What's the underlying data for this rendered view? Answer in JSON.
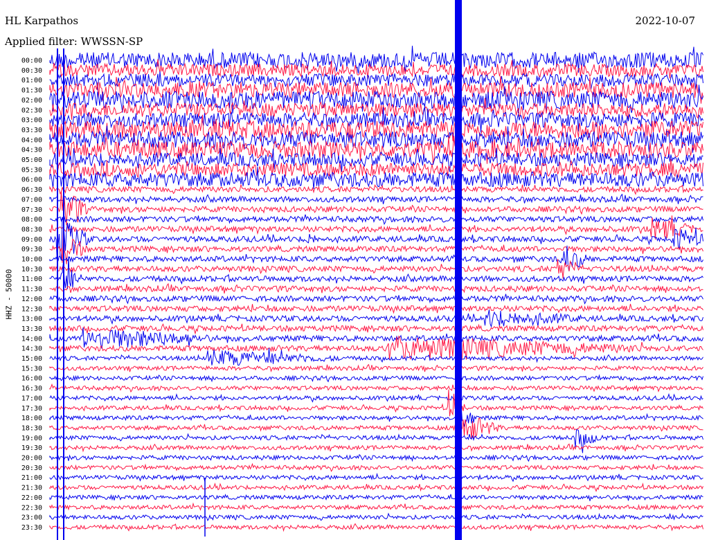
{
  "header": {
    "station": "HL Karpathos",
    "date": "2022-10-07",
    "filter": "Applied filter: WWSSN-SP"
  },
  "chart_data": {
    "type": "line",
    "title": "HL Karpathos",
    "subtitle": "Applied filter: WWSSN-SP",
    "ylabel": "HHZ - 50000",
    "xlabel": "",
    "row_labels": [
      "00:00",
      "00:30",
      "01:00",
      "01:30",
      "02:00",
      "02:30",
      "03:00",
      "03:30",
      "04:00",
      "04:30",
      "05:00",
      "05:30",
      "06:00",
      "06:30",
      "07:00",
      "07:30",
      "08:00",
      "08:30",
      "09:00",
      "09:30",
      "10:00",
      "10:30",
      "11:00",
      "11:30",
      "12:00",
      "12:30",
      "13:00",
      "13:30",
      "14:00",
      "14:30",
      "15:00",
      "15:30",
      "16:00",
      "16:30",
      "17:00",
      "17:30",
      "18:00",
      "18:30",
      "19:00",
      "19:30",
      "20:00",
      "20:30",
      "21:00",
      "21:30",
      "22:00",
      "22:30",
      "23:00",
      "23:30"
    ],
    "row_minutes": 30,
    "series_colors": [
      "#0000ee",
      "#ff1744"
    ],
    "grid": false,
    "legend": "none"
  }
}
